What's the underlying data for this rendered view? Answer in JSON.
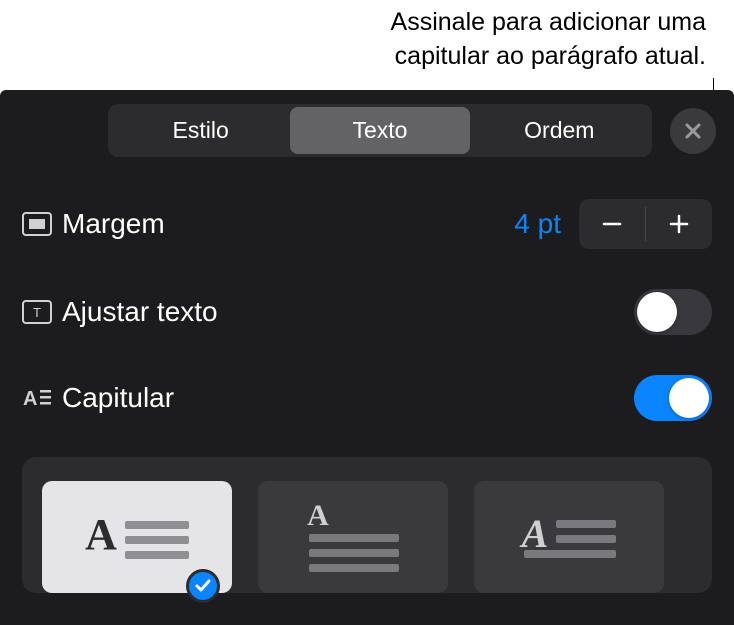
{
  "callout": {
    "line1": "Assinale para adicionar uma",
    "line2": "capitular ao parágrafo atual."
  },
  "tabs": {
    "items": [
      "Estilo",
      "Texto",
      "Ordem"
    ],
    "active_index": 1
  },
  "rows": {
    "margin": {
      "label": "Margem",
      "value": "4 pt"
    },
    "shrink_text": {
      "label": "Ajustar texto",
      "on": false
    },
    "drop_cap": {
      "label": "Capitular",
      "on": true
    }
  },
  "drop_cap_styles": {
    "selected_index": 0,
    "options": [
      "style-1",
      "style-2",
      "style-3"
    ]
  }
}
